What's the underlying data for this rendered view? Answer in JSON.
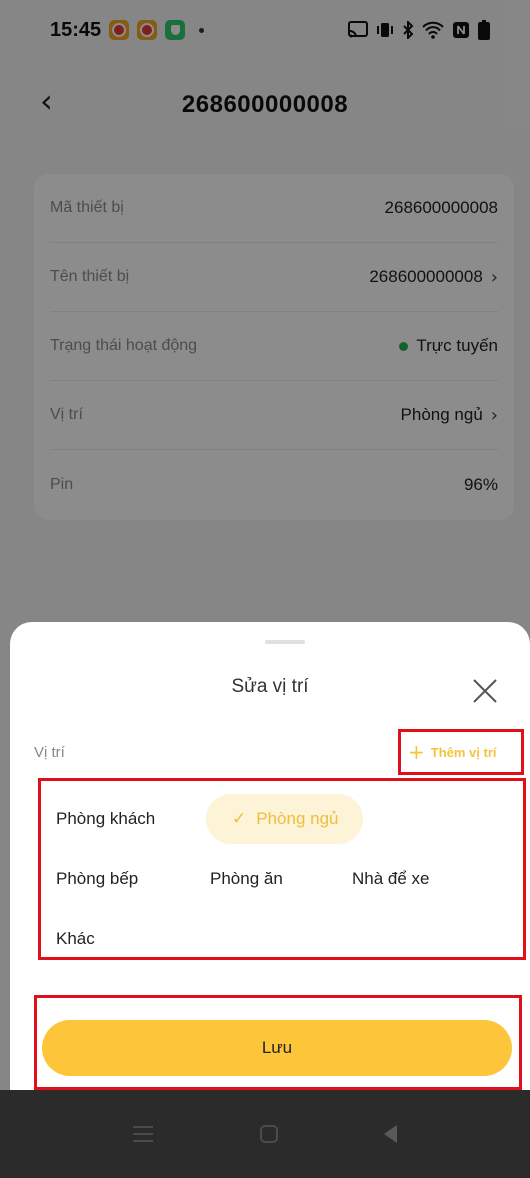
{
  "status_bar": {
    "time": "15:45",
    "icons": [
      "app-notification-icon",
      "app-notification-icon",
      "shield-app-icon",
      "cast-icon",
      "vibrate-icon",
      "bluetooth-icon",
      "wifi-icon",
      "nfc-icon",
      "battery-icon"
    ]
  },
  "header": {
    "title": "268600000008"
  },
  "device_info": {
    "rows": [
      {
        "label": "Mã thiết bị",
        "value": "268600000008"
      },
      {
        "label": "Tên thiết bị",
        "value": "268600000008"
      },
      {
        "label": "Trạng thái hoạt động",
        "value": "Trực tuyến"
      },
      {
        "label": "Vị trí",
        "value": "Phòng ngủ"
      },
      {
        "label": "Pin",
        "value": "96%"
      }
    ],
    "online_color": "#27b34b"
  },
  "sheet": {
    "title": "Sửa vị trí",
    "section_label": "Vị trí",
    "add_label": "Thêm vị trí",
    "locations": [
      "Phòng khách",
      "Phòng ngủ",
      "Phòng bếp",
      "Phòng ăn",
      "Nhà để xe",
      "Khác"
    ],
    "selected": "Phòng ngủ",
    "save_label": "Lưu"
  },
  "colors": {
    "accent": "#fdc53a",
    "selected_text": "#f0be3d",
    "selected_bg": "#fdf3d6",
    "highlight": "#e0101a"
  }
}
